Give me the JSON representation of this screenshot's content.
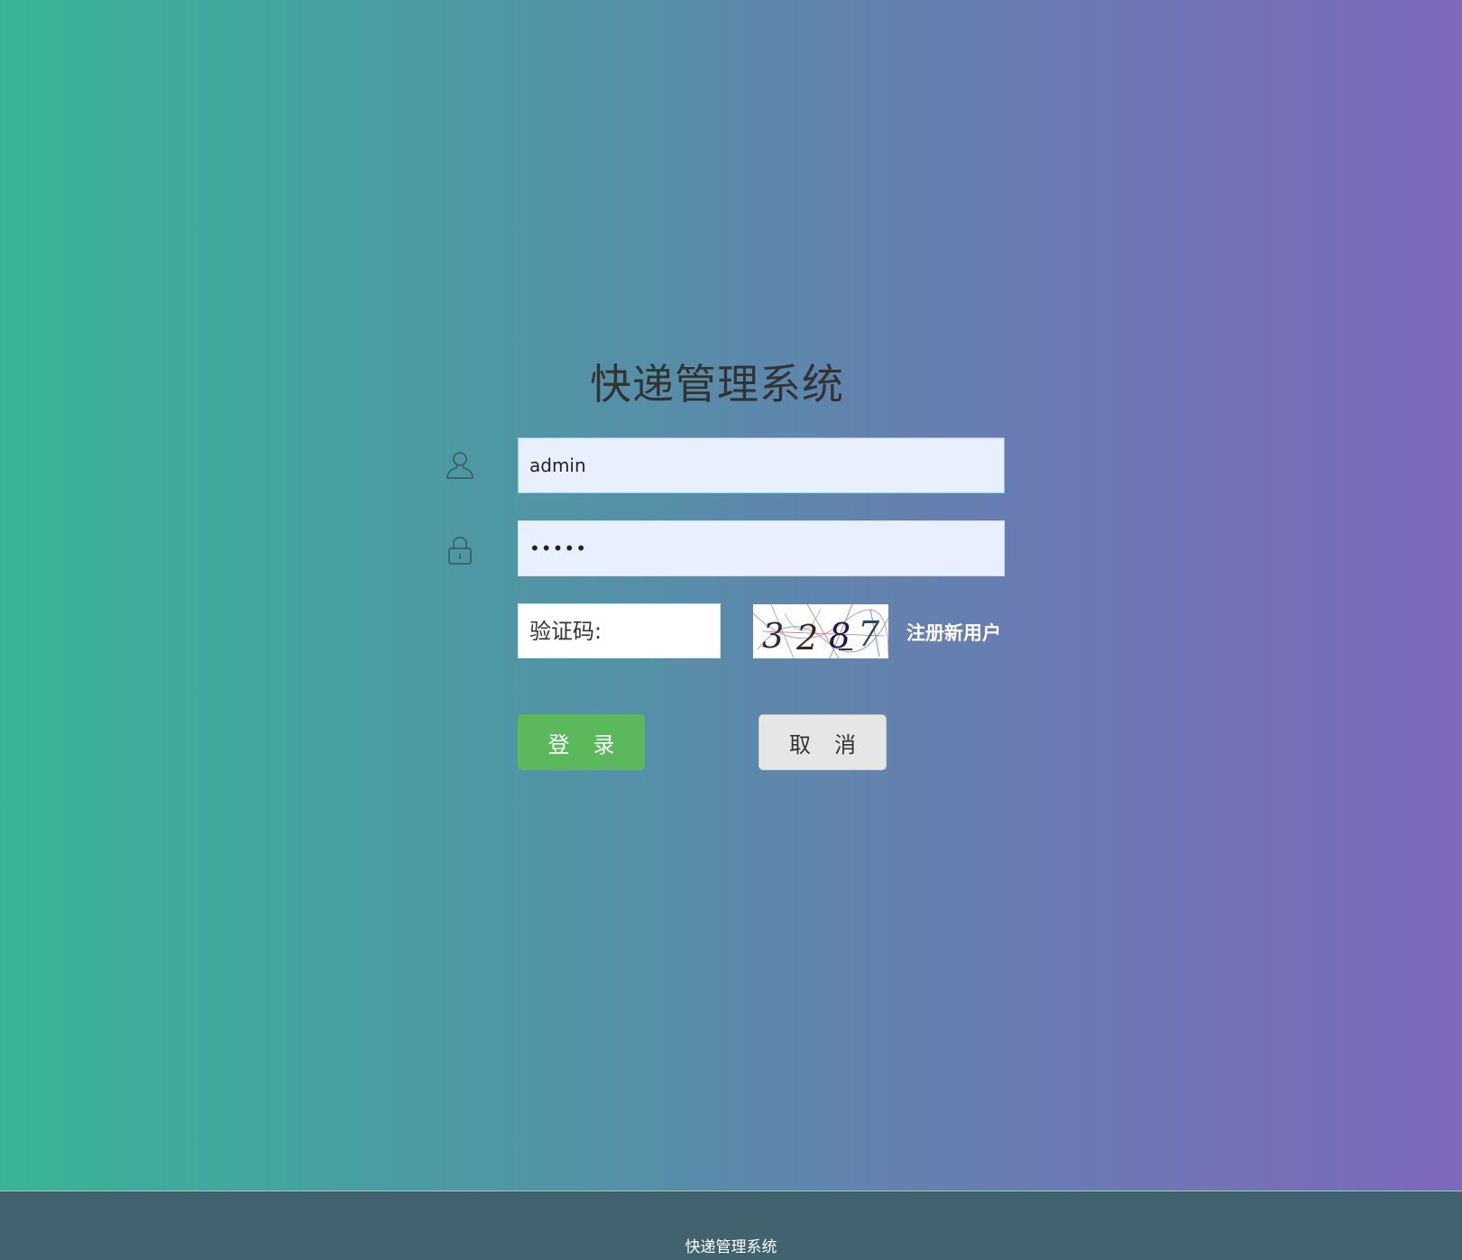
{
  "app": {
    "title": "快递管理系统"
  },
  "login_form": {
    "username": {
      "value": "admin",
      "icon": "user-icon"
    },
    "password": {
      "value": "•••••",
      "icon": "lock-icon"
    },
    "captcha": {
      "placeholder": "验证码:",
      "value": "",
      "image_text": "3287"
    },
    "register_link": "注册新用户",
    "login_button": "登录",
    "cancel_button": "取消"
  },
  "footer": {
    "text": "快递管理系统"
  },
  "colors": {
    "gradient_start": "#37b595",
    "gradient_end": "#7d68bd",
    "login_button": "#5cb85c",
    "cancel_button": "#e6e6e6",
    "footer_bg": "#41626f",
    "input_filled_bg": "#e8f0fe"
  }
}
